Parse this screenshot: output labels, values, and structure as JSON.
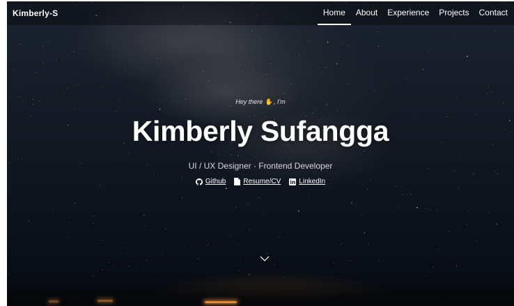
{
  "nav": {
    "brand": "Kimberly-S",
    "links": [
      {
        "label": "Home",
        "active": true
      },
      {
        "label": "About",
        "active": false
      },
      {
        "label": "Experience",
        "active": false
      },
      {
        "label": "Projects",
        "active": false
      },
      {
        "label": "Contact",
        "active": false
      }
    ]
  },
  "hero": {
    "greeting_pre": "Hey there",
    "greeting_post": ", I'm",
    "wave_icon": "waving-hand-icon",
    "name": "Kimberly Sufangga",
    "role": "UI / UX Designer · Frontend Developer",
    "links": [
      {
        "label": "Github",
        "icon": "github-icon"
      },
      {
        "label": "Resume/CV",
        "icon": "document-icon"
      },
      {
        "label": "LinkedIn",
        "icon": "linkedin-icon"
      }
    ],
    "scroll_icon": "chevron-down-icon"
  },
  "colors": {
    "text": "#ffffff",
    "subtext": "#d9d9d9",
    "accent_glow": "#d98a3a",
    "background_top": "#1b2330",
    "background_bottom": "#060a10"
  }
}
